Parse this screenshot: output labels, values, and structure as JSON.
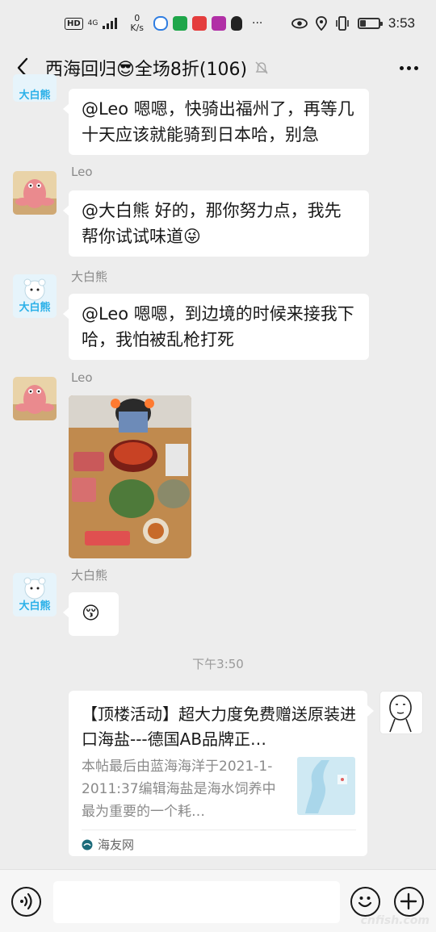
{
  "status_bar": {
    "hd": "HD",
    "network": "4G",
    "speed_value": "0",
    "speed_unit": "K/s",
    "time": "3:53",
    "battery_level": 0.3,
    "app_icons": [
      "baidu-map-icon",
      "lin-app-icon",
      "red-app-icon",
      "font-app-icon",
      "qq-icon"
    ],
    "overflow": "···"
  },
  "header": {
    "title": "西海回归😎全场8折(106)"
  },
  "messages": [
    {
      "type": "text",
      "sender": "",
      "text": "@Leo  嗯嗯，快骑出福州了，再等几十天应该就能骑到日本哈，别急"
    },
    {
      "type": "text",
      "sender": "Leo",
      "text": "@大白熊  好的，那你努力点，我先帮你试试味道😜"
    },
    {
      "type": "text",
      "sender": "大白熊",
      "text": "@Leo  嗯嗯，到边境的时候来接我下哈，我怕被乱枪打死"
    },
    {
      "type": "image",
      "sender": "Leo"
    },
    {
      "type": "emoji",
      "sender": "大白熊",
      "text": "😚"
    }
  ],
  "avatar_text": {
    "bear": "大白熊"
  },
  "timestamp": "下午3:50",
  "link_card": {
    "title": "【顶楼活动】超大力度免费赠送原装进口海盐---德国AB品牌正…",
    "description": "本帖最后由蓝海海洋于2021-1-2011:37编辑海盐是海水饲养中最为重要的一个耗…",
    "source": "海友网"
  },
  "input_bar": {
    "placeholder": ""
  },
  "watermark": "cnfish.com",
  "colors": {
    "background": "#ededed",
    "bubble": "#ffffff",
    "text": "#191919",
    "secondary": "#8a8a8a"
  }
}
